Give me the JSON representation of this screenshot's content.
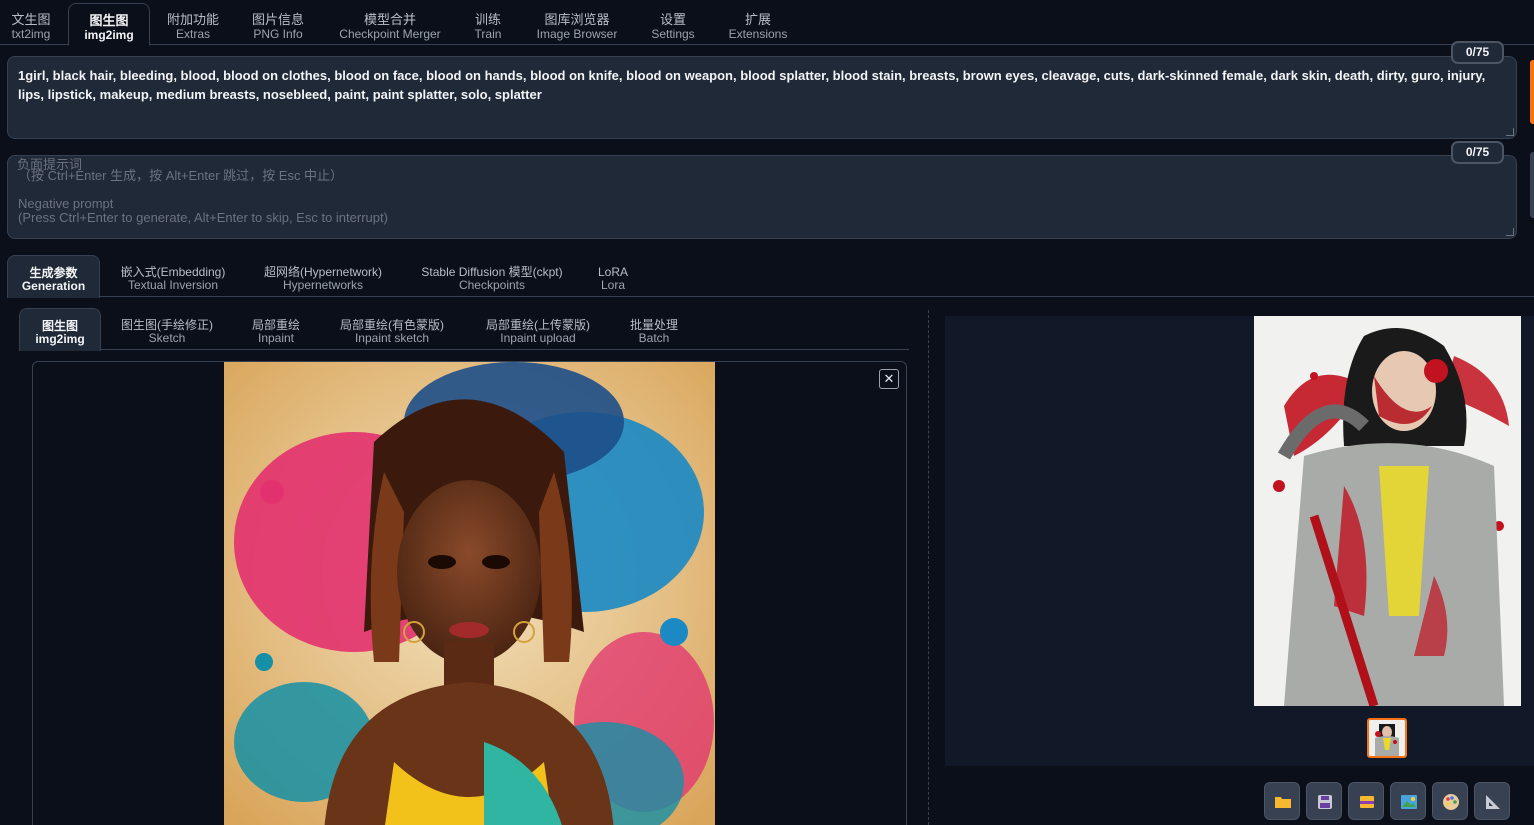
{
  "top_tabs": [
    {
      "zh": "文生图",
      "en": "txt2img"
    },
    {
      "zh": "图生图",
      "en": "img2img"
    },
    {
      "zh": "附加功能",
      "en": "Extras"
    },
    {
      "zh": "图片信息",
      "en": "PNG Info"
    },
    {
      "zh": "模型合并",
      "en": "Checkpoint Merger"
    },
    {
      "zh": "训练",
      "en": "Train"
    },
    {
      "zh": "图库浏览器",
      "en": "Image Browser"
    },
    {
      "zh": "设置",
      "en": "Settings"
    },
    {
      "zh": "扩展",
      "en": "Extensions"
    }
  ],
  "prompt": {
    "text": "1girl, black hair, bleeding, blood, blood on clothes, blood on face, blood on hands, blood on knife, blood on weapon, blood splatter, blood stain, breasts, brown eyes, cleavage, cuts, dark-skinned female, dark skin, death, dirty, guro, injury, lips, lipstick, makeup, medium breasts, nosebleed, paint, paint splatter, solo, splatter",
    "counter": "0/75"
  },
  "negative_prompt": {
    "label": "负面提示词",
    "placeholder_zh": "（按 Ctrl+Enter 生成，按 Alt+Enter 跳过，按 Esc 中止）",
    "placeholder_en_1": "Negative prompt",
    "placeholder_en_2": "(Press Ctrl+Enter to generate, Alt+Enter to skip, Esc to interrupt)",
    "counter": "0/75"
  },
  "section_tabs": [
    {
      "zh": "生成参数",
      "en": "Generation"
    },
    {
      "zh": "嵌入式(Embedding)",
      "en": "Textual Inversion"
    },
    {
      "zh": "超网络(Hypernetwork)",
      "en": "Hypernetworks"
    },
    {
      "zh": "Stable Diffusion 模型(ckpt)",
      "en": "Checkpoints"
    },
    {
      "zh": "LoRA",
      "en": "Lora"
    }
  ],
  "sub_tabs": [
    {
      "zh": "图生图",
      "en": "img2img"
    },
    {
      "zh": "图生图(手绘修正)",
      "en": "Sketch"
    },
    {
      "zh": "局部重绘",
      "en": "Inpaint"
    },
    {
      "zh": "局部重绘(有色蒙版)",
      "en": "Inpaint sketch"
    },
    {
      "zh": "局部重绘(上传蒙版)",
      "en": "Inpaint upload"
    },
    {
      "zh": "批量处理",
      "en": "Batch"
    }
  ],
  "close_glyph": "✕",
  "toolbar_icons": [
    "folder-icon",
    "save-icon",
    "zip-icon",
    "image-icon",
    "palette-icon",
    "ruler-icon"
  ],
  "colors": {
    "accent": "#f97316",
    "background": "#0b0f19",
    "panel": "#1f2937"
  }
}
